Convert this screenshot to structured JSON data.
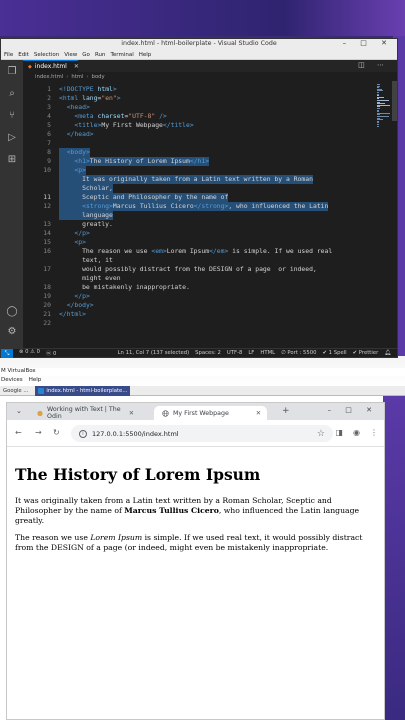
{
  "vscode": {
    "title": "index.html - html-boilerplate - Visual Studio Code",
    "menu": [
      "File",
      "Edit",
      "Selection",
      "View",
      "Go",
      "Run",
      "Terminal",
      "Help"
    ],
    "tab_label": "index.html",
    "breadcrumb": [
      "index.html",
      "html",
      "body"
    ],
    "lines": [
      {
        "n": "1",
        "code": "<!DOCTYPE html>"
      },
      {
        "n": "2",
        "code": "<html lang=\"en\">"
      },
      {
        "n": "3",
        "code": "  <head>"
      },
      {
        "n": "4",
        "code": "    <meta charset=\"UTF-8\" />"
      },
      {
        "n": "5",
        "code": "    <title>My First Webpage</title>"
      },
      {
        "n": "6",
        "code": "  </head>"
      },
      {
        "n": "7",
        "code": ""
      },
      {
        "n": "8",
        "code": "  <body>"
      },
      {
        "n": "9",
        "code": "    <h1>The History of Lorem Ipsum</h1>"
      },
      {
        "n": "10",
        "code": "    <p>"
      },
      {
        "n": "",
        "code": "      It was originally taken from a Latin text written by a Roman"
      },
      {
        "n": "",
        "code": "      Scholar,"
      },
      {
        "n": "11",
        "code": "      Sceptic and Philosopher by the name of"
      },
      {
        "n": "12",
        "code": "      <strong>Marcus Tullius Cicero</strong>, who influenced the Latin"
      },
      {
        "n": "",
        "code": "      language"
      },
      {
        "n": "13",
        "code": "      greatly."
      },
      {
        "n": "14",
        "code": "    </p>"
      },
      {
        "n": "15",
        "code": "    <p>"
      },
      {
        "n": "16",
        "code": "      The reason we use <em>Lorem Ipsum</em> is simple. If we used real"
      },
      {
        "n": "",
        "code": "      text, it"
      },
      {
        "n": "17",
        "code": "      would possibly distract from the DESIGN of a page  or indeed,"
      },
      {
        "n": "",
        "code": "      might even"
      },
      {
        "n": "18",
        "code": "      be mistakenly inappropriate."
      },
      {
        "n": "19",
        "code": "    </p>"
      },
      {
        "n": "20",
        "code": "  </body>"
      },
      {
        "n": "21",
        "code": "</html>"
      },
      {
        "n": "22",
        "code": ""
      }
    ],
    "status": {
      "errors": "⊗ 0 ⚠ 0",
      "ports": "ⓦ 0",
      "position": "Ln 11, Col 7 (137 selected)",
      "spaces": "Spaces: 2",
      "encoding": "UTF-8",
      "eol": "LF",
      "language": "HTML",
      "port": "∅ Port : 5500",
      "spell": "✔ 1 Spell",
      "prettier": "✔ Prettier"
    }
  },
  "desktop": {
    "virtualbox": "M VirtualBox",
    "vbox_menu": [
      "Devices",
      "Help"
    ],
    "tasks": [
      "Google ...",
      "index.html - html-boilerplate..."
    ]
  },
  "browser": {
    "tab1": "Working with Text | The Odin",
    "tab2": "My First Webpage",
    "url": "127.0.0.1:5500/index.html",
    "heading": "The History of Lorem Ipsum",
    "para1_a": "It was originally taken from a Latin text written by a Roman Scholar, Sceptic and Philosopher by the name of ",
    "para1_strong": "Marcus Tullius Cicero",
    "para1_b": ", who influenced the Latin language greatly.",
    "para2_a": "The reason we use ",
    "para2_em": "Lorem Ipsum",
    "para2_b": " is simple. If we used real text, it would possibly distract from the DESIGN of a page (or indeed, might even be mistakenly inappropriate."
  }
}
